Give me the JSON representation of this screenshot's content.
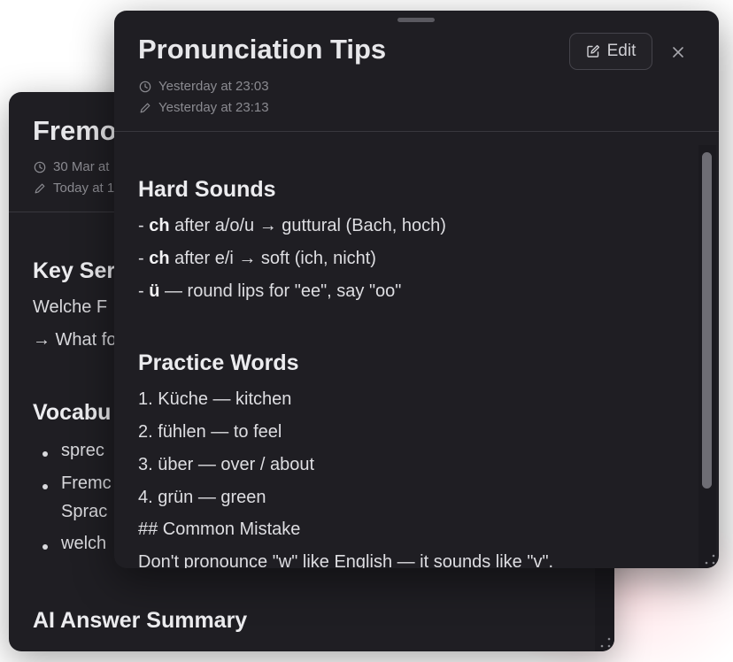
{
  "back_note": {
    "title": "Fremo",
    "created": "30 Mar at",
    "edited": "Today at 1",
    "section1_heading": "Key Ser",
    "section1_line1": "Welche F",
    "section1_line2": "→ What fo",
    "section2_heading": "Vocabu",
    "vocab": [
      "sprec",
      "Fremc",
      "Sprac",
      "welch"
    ],
    "section3_heading": "AI Answer Summary"
  },
  "front_note": {
    "title": "Pronunciation Tips",
    "created": "Yesterday at 23:03",
    "edited": "Yesterday at 23:13",
    "edit_label": "Edit",
    "hard_sounds": {
      "heading": "Hard Sounds",
      "items": [
        {
          "prefix": "- ",
          "bold": "ch",
          "rest": " after a/o/u → guttural (Bach, hoch)"
        },
        {
          "prefix": "- ",
          "bold": "ch",
          "rest": " after e/i → soft (ich, nicht)"
        },
        {
          "prefix": "- ",
          "bold": "ü",
          "rest": " — round lips for \"ee\", say \"oo\""
        }
      ]
    },
    "practice_words": {
      "heading": "Practice Words",
      "items": [
        "1. Küche — kitchen",
        "2. fühlen — to feel",
        "3. über — over / about",
        "4. grün — green"
      ]
    },
    "common_mistake_heading": "## Common Mistake",
    "common_mistake_text": "Don't pronounce \"w\" like English — it sounds like \"v\"."
  },
  "icons": [
    "clock-icon",
    "pencil-icon",
    "edit-icon",
    "close-icon",
    "resize-grip-icon"
  ],
  "colors": {
    "card_bg": "#1f1e23",
    "text": "#e7e7ea",
    "muted": "#8a8a90"
  }
}
